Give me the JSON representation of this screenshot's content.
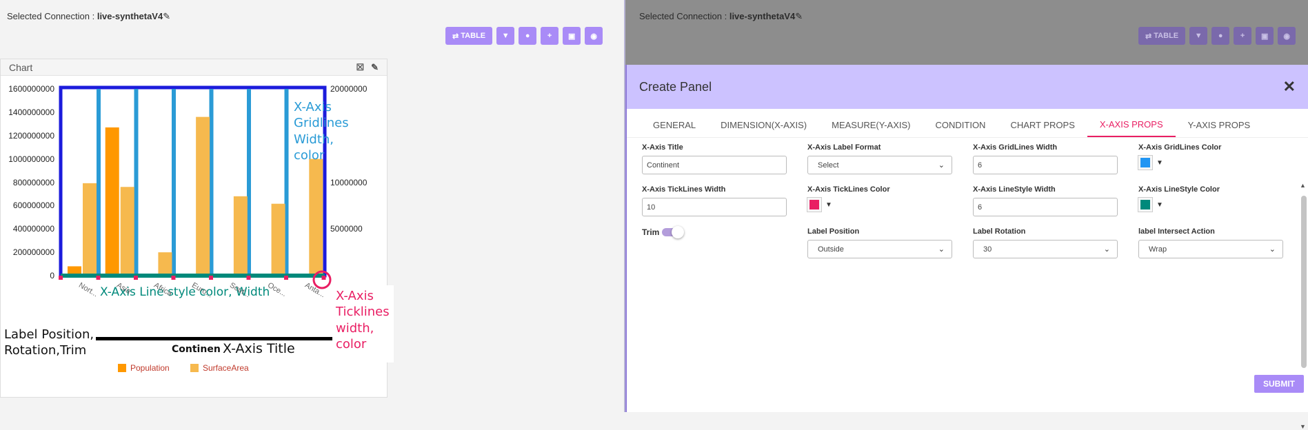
{
  "left": {
    "connection_label": "Selected Connection :",
    "connection_name": "live-synthetaV4",
    "toolbar": {
      "table_label": "TABLE"
    },
    "card_title": "Chart"
  },
  "chart_data": {
    "type": "bar",
    "categories": [
      "Nort...",
      "Asia",
      "Africa",
      "Euro...",
      "Sout...",
      "Oce...",
      "Anta..."
    ],
    "series": [
      {
        "name": "Population",
        "values": [
          80000000,
          1270000000,
          0,
          0,
          0,
          0,
          0
        ],
        "color": "#ff9800"
      },
      {
        "name": "SurfaceArea",
        "values": [
          9900000,
          9500000,
          2500000,
          17000000,
          8500000,
          7700000,
          12500000
        ],
        "color": "#f6b94e"
      }
    ],
    "y_ticks": [
      "1600000000",
      "1400000000",
      "1200000000",
      "1000000000",
      "800000000",
      "600000000",
      "400000000",
      "200000000",
      "0"
    ],
    "y2_ticks": [
      "20000000",
      "10000000",
      "5000000"
    ],
    "ylim": [
      0,
      1600000000
    ],
    "y2lim": [
      0,
      20000000
    ],
    "xlabel": "Continent",
    "legend": [
      "Population",
      "SurfaceArea"
    ]
  },
  "annotations": {
    "gridlines": [
      "X-Axis",
      "Gridlines",
      "Width,",
      "color"
    ],
    "linestyle": "X-Axis Line style color, Width",
    "ticklines": [
      "X-Axis",
      "Ticklines",
      "width,",
      "color"
    ],
    "labelpos": [
      "Label Position,",
      "Rotation,Trim"
    ],
    "xtitle": "X-Axis Title"
  },
  "right": {
    "connection_label": "Selected Connection :",
    "connection_name": "live-synthetaV4",
    "table_label": "TABLE",
    "panel_title": "Create Panel",
    "tabs": [
      "GENERAL",
      "DIMENSION(X-AXIS)",
      "MEASURE(Y-AXIS)",
      "CONDITION",
      "CHART PROPS",
      "X-AXIS PROPS",
      "Y-AXIS PROPS"
    ],
    "fields": {
      "xtitle_label": "X-Axis Title",
      "xtitle_value": "Continent",
      "labelformat_label": "X-Axis Label Format",
      "labelformat_value": "Select",
      "gridwidth_label": "X-Axis GridLines Width",
      "gridwidth_value": "6",
      "gridcolor_label": "X-Axis GridLines Color",
      "gridcolor": "#2196f3",
      "tickwidth_label": "X-Axis TickLines Width",
      "tickwidth_value": "10",
      "tickcolor_label": "X-Axis TickLines Color",
      "tickcolor": "#e91e63",
      "linewidth_label": "X-Axis LineStyle Width",
      "linewidth_value": "6",
      "linecolor_label": "X-Axis LineStyle Color",
      "linecolor": "#00897b",
      "trim_label": "Trim",
      "labelpos_label": "Label Position",
      "labelpos_value": "Outside",
      "rotation_label": "Label Rotation",
      "rotation_value": "30",
      "intersect_label": "label Intersect Action",
      "intersect_value": "Wrap"
    },
    "submit_label": "SUBMIT"
  }
}
